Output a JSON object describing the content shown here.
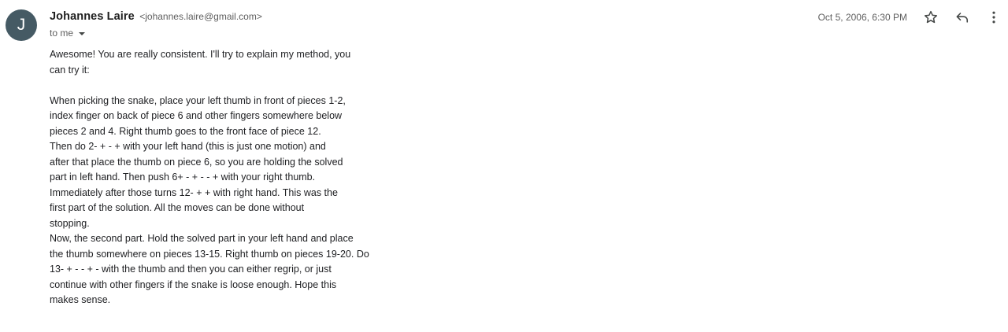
{
  "sender": {
    "avatar_letter": "J",
    "avatar_color": "#455a64",
    "name": "Johannes Laire",
    "email": "<johannes.laire@gmail.com>"
  },
  "recipient_label": "to me",
  "timestamp": "Oct 5, 2006, 6:30 PM",
  "actions": {
    "star_icon": "star-outline",
    "reply_icon": "reply-arrow",
    "more_icon": "vertical-dots"
  },
  "body_lines": [
    "Awesome! You are really consistent. I'll try to explain my method, you",
    "can try it:",
    "",
    "When picking the snake, place your left thumb in front of pieces 1-2,",
    "index finger on back of piece 6 and other fingers somewhere below",
    "pieces 2 and 4. Right thumb goes to the front face of piece 12.",
    "Then do 2- + - + with your left hand (this is just one motion) and",
    "after that place the thumb on piece 6, so you are holding the solved",
    "part in left hand. Then push 6+ - + - - + with your right thumb.",
    "Immediately after those turns 12- + + with right hand. This was the",
    "first part of the solution. All the moves can be done without",
    "stopping.",
    "Now, the second part. Hold the solved part in your left hand and place",
    "the thumb somewhere on pieces 13-15. Right thumb on pieces 19-20. Do",
    "13- + - - + - with the thumb and then you can either regrip, or just",
    "continue with other fingers if the snake is loose enough. Hope this",
    "makes sense."
  ]
}
